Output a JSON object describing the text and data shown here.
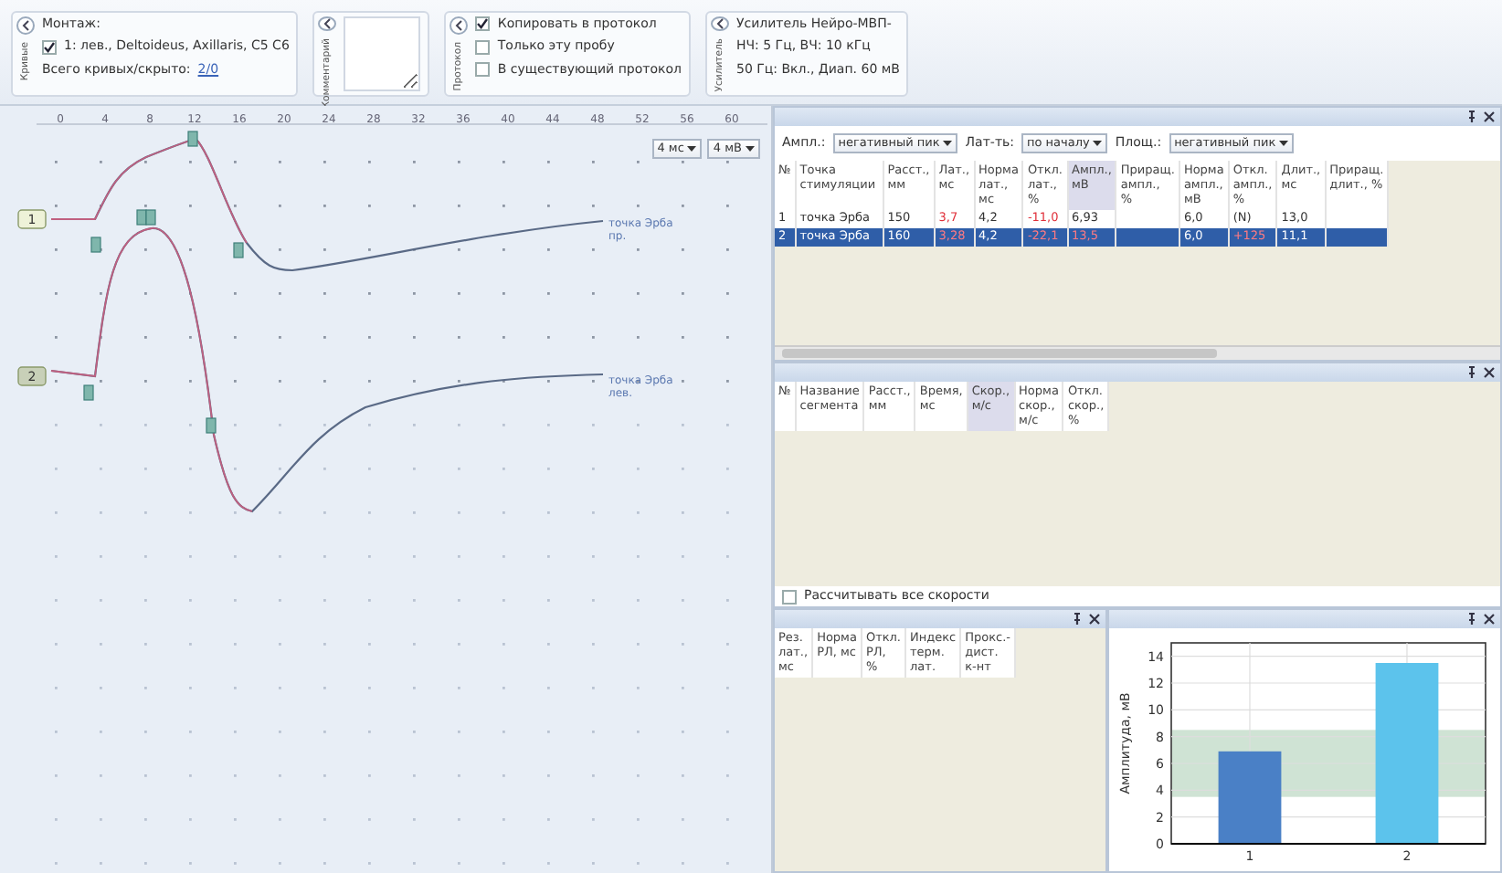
{
  "ribbon": {
    "groups": [
      {
        "kind": "montage",
        "caption": "Кривые",
        "title": "Монтаж:",
        "montage": {
          "label": "1: лев., Deltoideus, Axillaris, C5 C6",
          "checked": true
        },
        "summary_label": "Всего кривых/скрыто:",
        "summary_value": "2/0"
      },
      {
        "kind": "comment",
        "caption": "Комментарий"
      },
      {
        "kind": "checks",
        "caption": "Протокол",
        "options": [
          {
            "label": "Копировать в протокол",
            "checked": true
          },
          {
            "label": "Только эту пробу",
            "checked": false
          },
          {
            "label": "В существующий протокол",
            "checked": false
          }
        ]
      },
      {
        "kind": "info",
        "caption": "Усилитель",
        "lines": [
          "Усилитель Нейро-МВП-",
          "НЧ: 5 Гц, ВЧ: 10 кГц",
          "50 Гц: Вкл., Диап. 60 мВ"
        ]
      }
    ]
  },
  "curves": {
    "scale": [
      "0",
      "4",
      "8",
      "12",
      "16",
      "20",
      "24",
      "28",
      "32",
      "36",
      "40",
      "44",
      "48",
      "52",
      "56",
      "60"
    ],
    "time_base": "4 мс",
    "gain": "4 мВ",
    "traces": [
      {
        "label": "1",
        "site": "точка Эрба пр."
      },
      {
        "label": "2",
        "site": "точка Эрба лев."
      }
    ]
  },
  "amplitude_panel": {
    "filters": [
      {
        "label": "Ампл.:",
        "value": "негативный пик"
      },
      {
        "label": "Лат-ть:",
        "value": "по началу"
      },
      {
        "label": "Площ.:",
        "value": "негативный пик"
      }
    ],
    "columns": [
      {
        "title": "№",
        "sorted": false
      },
      {
        "title": "Точка стимуляции",
        "sorted": false
      },
      {
        "title": "Расст., мм",
        "sorted": false
      },
      {
        "title": "Лат., мс",
        "sorted": false
      },
      {
        "title": "Норма лат., мс",
        "sorted": false
      },
      {
        "title": "Откл. лат., %",
        "sorted": false
      },
      {
        "title": "Ампл., мВ",
        "sorted": true
      },
      {
        "title": "Приращ. ампл., %",
        "sorted": false
      },
      {
        "title": "Норма ампл., мВ",
        "sorted": false
      },
      {
        "title": "Откл. ампл., %",
        "sorted": false
      },
      {
        "title": "Длит., мс",
        "sorted": false
      },
      {
        "title": "Приращ. длит., %",
        "sorted": false
      }
    ],
    "rows": [
      {
        "selected": false,
        "cells": [
          {
            "text": "1",
            "abnormal": false
          },
          {
            "text": "точка Эрба",
            "abnormal": false
          },
          {
            "text": "150",
            "abnormal": false
          },
          {
            "text": "3,7",
            "abnormal": true
          },
          {
            "text": "4,2",
            "abnormal": false
          },
          {
            "text": "-11,0",
            "abnormal": true
          },
          {
            "text": "6,93",
            "abnormal": false
          },
          null,
          {
            "text": "6,0",
            "abnormal": false
          },
          {
            "text": "(N)",
            "abnormal": false
          },
          {
            "text": "13,0",
            "abnormal": false
          },
          null
        ]
      },
      {
        "selected": true,
        "cells": [
          {
            "text": "2",
            "abnormal": false
          },
          {
            "text": "точка Эрба",
            "abnormal": false
          },
          {
            "text": "160",
            "abnormal": false
          },
          {
            "text": "3,28",
            "abnormal": true
          },
          {
            "text": "4,2",
            "abnormal": false
          },
          {
            "text": "-22,1",
            "abnormal": true
          },
          {
            "text": "13,5",
            "abnormal": true
          },
          null,
          {
            "text": "6,0",
            "abnormal": false
          },
          {
            "text": "+125",
            "abnormal": true
          },
          {
            "text": "11,1",
            "abnormal": false
          },
          null
        ]
      }
    ]
  },
  "velocity_panel": {
    "columns": [
      {
        "title": "№",
        "sorted": false
      },
      {
        "title": "Название сегмента",
        "sorted": false
      },
      {
        "title": "Расст., мм",
        "sorted": false
      },
      {
        "title": "Время, мс",
        "sorted": false
      },
      {
        "title": "Скор., м/с",
        "sorted": true
      },
      {
        "title": "Норма скор., м/с",
        "sorted": false
      },
      {
        "title": "Откл. скор., %",
        "sorted": false
      }
    ],
    "calc_all": {
      "label": "Рассчитывать все скорости",
      "checked": false
    }
  },
  "latency_panel": {
    "columns": [
      "Рез. лат., мс",
      "Норма РЛ, мс",
      "Откл. РЛ, %",
      "Индекс терм. лат.",
      "Прокс.-дист. к-нт"
    ]
  },
  "chart_panel": {
    "chart_data": {
      "type": "bar",
      "ylabel": "Амплитуда, мВ",
      "categories": [
        "1",
        "2"
      ],
      "values": [
        6.9,
        13.5
      ],
      "colors": [
        "#4a80c6",
        "#5cc3ec"
      ],
      "ylim": [
        0,
        15
      ],
      "yticks": [
        0,
        2,
        4,
        6,
        8,
        10,
        12,
        14
      ],
      "grid": true,
      "bands": [
        {
          "axis": "y",
          "from": 3.5,
          "to": 8.5,
          "color": "#cfe3d4"
        }
      ]
    }
  }
}
